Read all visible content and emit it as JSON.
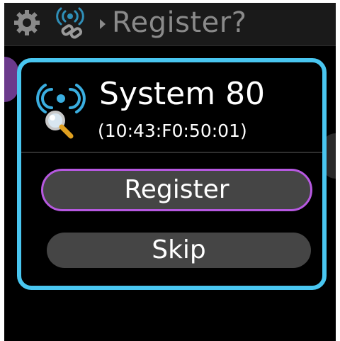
{
  "header": {
    "title": "Register?",
    "settings_icon": "gear-icon",
    "connection_icon": "wireless-link-icon",
    "separator_icon": "chevron-right-icon"
  },
  "dialog": {
    "device_name": "System 80",
    "device_address": "(10:43:F0:50:01)",
    "device_icon": "wireless-search-icon",
    "register_label": "Register",
    "skip_label": "Skip"
  },
  "colors": {
    "accent_border": "#49c6f0",
    "focus_outline": "#b658e0",
    "button_fill": "#454545",
    "header_text": "#8a8a8a"
  }
}
